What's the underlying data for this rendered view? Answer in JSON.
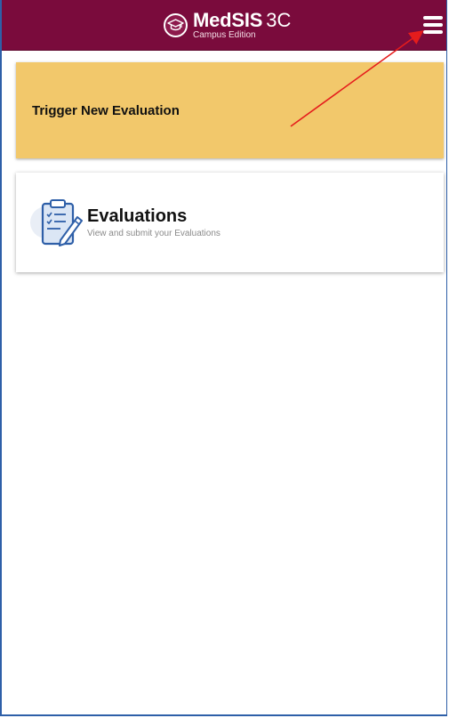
{
  "header": {
    "brand_name": "MedSIS",
    "brand_version": "3C",
    "brand_subtitle": "Campus Edition",
    "background_color": "#7a0b3c",
    "logo_icon": "graduation-cap-icon",
    "menu_icon": "hamburger-menu-icon"
  },
  "cards": {
    "trigger": {
      "title": "Trigger New Evaluation",
      "background_color": "#f2c86b"
    },
    "evaluations": {
      "title": "Evaluations",
      "subtitle": "View and submit your Evaluations",
      "icon": "clipboard-pencil-icon",
      "icon_color": "#2e5fa8"
    }
  },
  "annotation": {
    "type": "red-arrow",
    "color": "#e51c1c",
    "points_to": "menu-button"
  }
}
